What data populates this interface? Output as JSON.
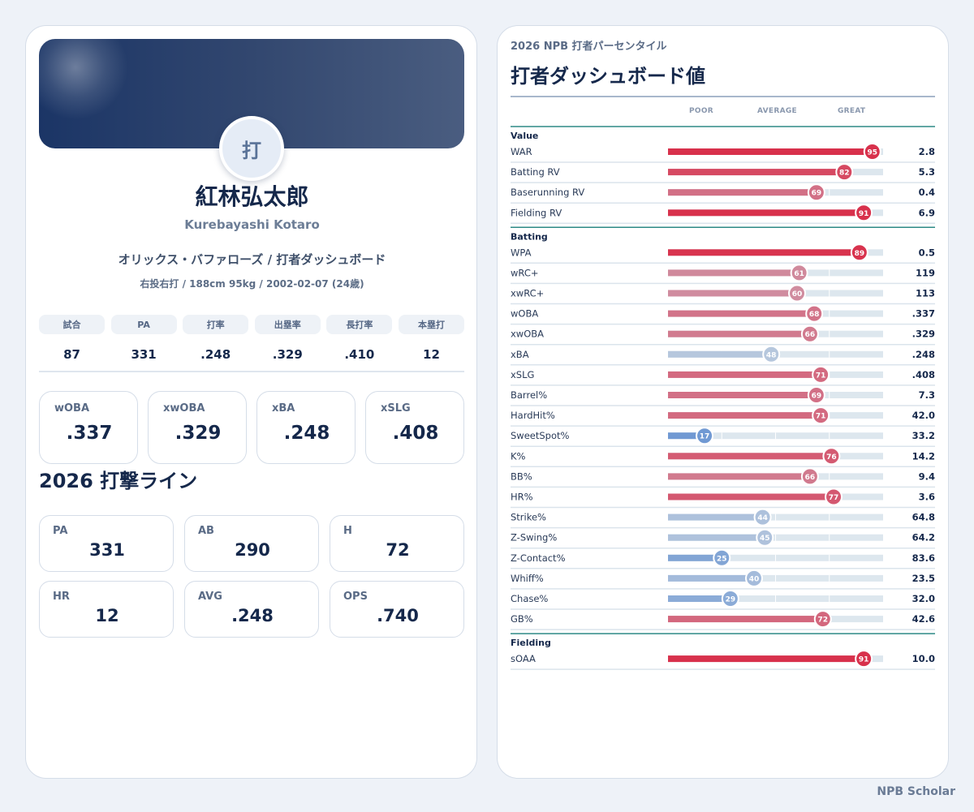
{
  "player": {
    "avatar_char": "打",
    "name": "紅林弘太郎",
    "roman": "Kurebayashi Kotaro",
    "team_line": "オリックス・バファローズ / 打者ダッシュボード",
    "bio": "右投右打 / 188cm 95kg / 2002-02-07 (24歳)"
  },
  "summary": [
    {
      "label": "試合",
      "value": "87"
    },
    {
      "label": "PA",
      "value": "331"
    },
    {
      "label": "打率",
      "value": ".248"
    },
    {
      "label": "出塁率",
      "value": ".329"
    },
    {
      "label": "長打率",
      "value": ".410"
    },
    {
      "label": "本塁打",
      "value": "12"
    }
  ],
  "metrics": [
    {
      "label": "wOBA",
      "value": ".337"
    },
    {
      "label": "xwOBA",
      "value": ".329"
    },
    {
      "label": "xBA",
      "value": ".248"
    },
    {
      "label": "xSLG",
      "value": ".408"
    }
  ],
  "batting_line": {
    "title": "2026 打撃ライン",
    "items": [
      {
        "label": "PA",
        "value": "331"
      },
      {
        "label": "AB",
        "value": "290"
      },
      {
        "label": "H",
        "value": "72"
      },
      {
        "label": "HR",
        "value": "12"
      },
      {
        "label": "AVG",
        "value": ".248"
      },
      {
        "label": "OPS",
        "value": ".740"
      }
    ]
  },
  "percentile": {
    "subtitle": "2026 NPB 打者パーセンタイル",
    "title": "打者ダッシュボード値",
    "scale": {
      "poor": "POOR",
      "average": "AVERAGE",
      "great": "GREAT"
    },
    "colors": {
      "good": "#d8314c",
      "bad": "#6b96d2",
      "neutral": "#c9d3e0",
      "track": "#dde7ee",
      "rule": "#2e8a86"
    },
    "sections": [
      {
        "name": "Value",
        "rows": [
          {
            "label": "WAR",
            "pct": 95,
            "value": "2.8"
          },
          {
            "label": "Batting RV",
            "pct": 82,
            "value": "5.3"
          },
          {
            "label": "Baserunning RV",
            "pct": 69,
            "value": "0.4"
          },
          {
            "label": "Fielding RV",
            "pct": 91,
            "value": "6.9"
          }
        ]
      },
      {
        "name": "Batting",
        "rows": [
          {
            "label": "WPA",
            "pct": 89,
            "value": "0.5"
          },
          {
            "label": "wRC+",
            "pct": 61,
            "value": "119"
          },
          {
            "label": "xwRC+",
            "pct": 60,
            "value": "113"
          },
          {
            "label": "wOBA",
            "pct": 68,
            "value": ".337"
          },
          {
            "label": "xwOBA",
            "pct": 66,
            "value": ".329"
          },
          {
            "label": "xBA",
            "pct": 48,
            "value": ".248"
          },
          {
            "label": "xSLG",
            "pct": 71,
            "value": ".408"
          },
          {
            "label": "Barrel%",
            "pct": 69,
            "value": "7.3"
          },
          {
            "label": "HardHit%",
            "pct": 71,
            "value": "42.0"
          },
          {
            "label": "SweetSpot%",
            "pct": 17,
            "value": "33.2"
          },
          {
            "label": "K%",
            "pct": 76,
            "value": "14.2"
          },
          {
            "label": "BB%",
            "pct": 66,
            "value": "9.4"
          },
          {
            "label": "HR%",
            "pct": 77,
            "value": "3.6"
          },
          {
            "label": "Strike%",
            "pct": 44,
            "value": "64.8"
          },
          {
            "label": "Z-Swing%",
            "pct": 45,
            "value": "64.2"
          },
          {
            "label": "Z-Contact%",
            "pct": 25,
            "value": "83.6"
          },
          {
            "label": "Whiff%",
            "pct": 40,
            "value": "23.5"
          },
          {
            "label": "Chase%",
            "pct": 29,
            "value": "32.0"
          },
          {
            "label": "GB%",
            "pct": 72,
            "value": "42.6"
          }
        ]
      },
      {
        "name": "Fielding",
        "rows": [
          {
            "label": "sOAA",
            "pct": 91,
            "value": "10.0"
          }
        ]
      }
    ]
  },
  "footer": "NPB Scholar"
}
